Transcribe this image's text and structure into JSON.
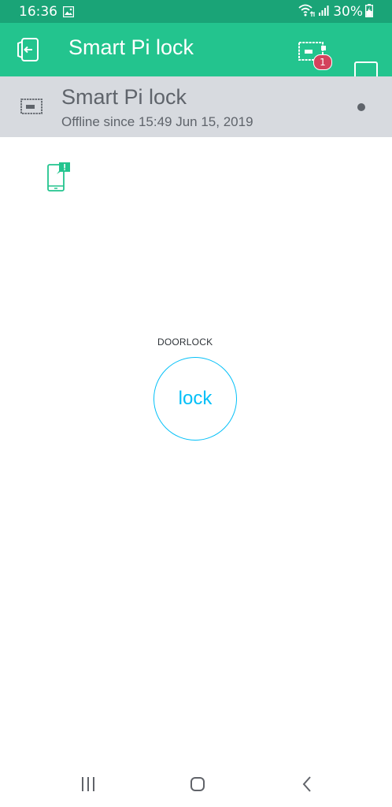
{
  "status_bar": {
    "time": "16:36",
    "battery_percent": "30%",
    "icons": [
      "gallery-icon",
      "wifi-icon",
      "signal-icon",
      "battery-charging-icon"
    ]
  },
  "app_bar": {
    "title": "Smart Pi lock",
    "device_badge_count": "1",
    "icons": [
      "exit-icon",
      "device-icon",
      "square-icon"
    ],
    "colors": {
      "bar": "#23c48e",
      "status": "#1aa477",
      "badge": "#d3435c"
    }
  },
  "device": {
    "name": "Smart Pi lock",
    "status": "Offline since 15:49 Jun 15, 2019"
  },
  "widgets": {
    "notification": {
      "icon": "phone-notification-icon"
    },
    "button": {
      "label": "DOORLOCK",
      "text": "lock",
      "color": "#04c0f8"
    }
  },
  "nav_bar": {
    "icons": [
      "recents-icon",
      "home-icon",
      "back-icon"
    ]
  }
}
